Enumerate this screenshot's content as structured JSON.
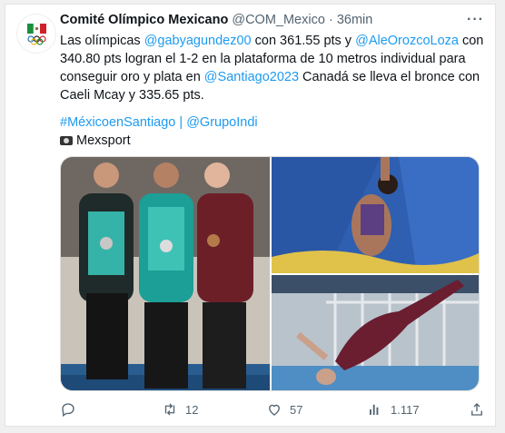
{
  "tweet": {
    "author_name": "Comité Olímpico Mexicano",
    "author_handle": "@COM_Mexico",
    "separator": "·",
    "time": "36min",
    "text_parts": [
      {
        "t": "Las olímpicas ",
        "link": false
      },
      {
        "t": "@gabyagundez00",
        "link": true
      },
      {
        "t": " con 361.55 pts y ",
        "link": false
      },
      {
        "t": "@AleOrozcoLoza",
        "link": true
      },
      {
        "t": " con 340.80 pts logran el 1-2 en la plataforma de 10 metros individual para conseguir oro y plata en ",
        "link": false
      },
      {
        "t": "@Santiago2023",
        "link": true
      },
      {
        "t": " Canadá se lleva el bronce con Caeli Mcay y 335.65 pts.",
        "link": false
      }
    ],
    "hashtag": "#MéxicoenSantiago",
    "tag_separator": " | ",
    "group_link": "@GrupoIndi",
    "credit": "Mexsport",
    "camera_icon": "camera-icon"
  },
  "actions": {
    "reply": {
      "icon": "reply-icon",
      "count": ""
    },
    "retweet": {
      "icon": "retweet-icon",
      "count": "12"
    },
    "like": {
      "icon": "heart-icon",
      "count": "57"
    },
    "views": {
      "icon": "views-icon",
      "count": "1.117"
    },
    "share": {
      "icon": "share-icon",
      "count": ""
    }
  },
  "colors": {
    "link": "#1d9bf0",
    "muted": "#536471",
    "text": "#0f1419"
  }
}
